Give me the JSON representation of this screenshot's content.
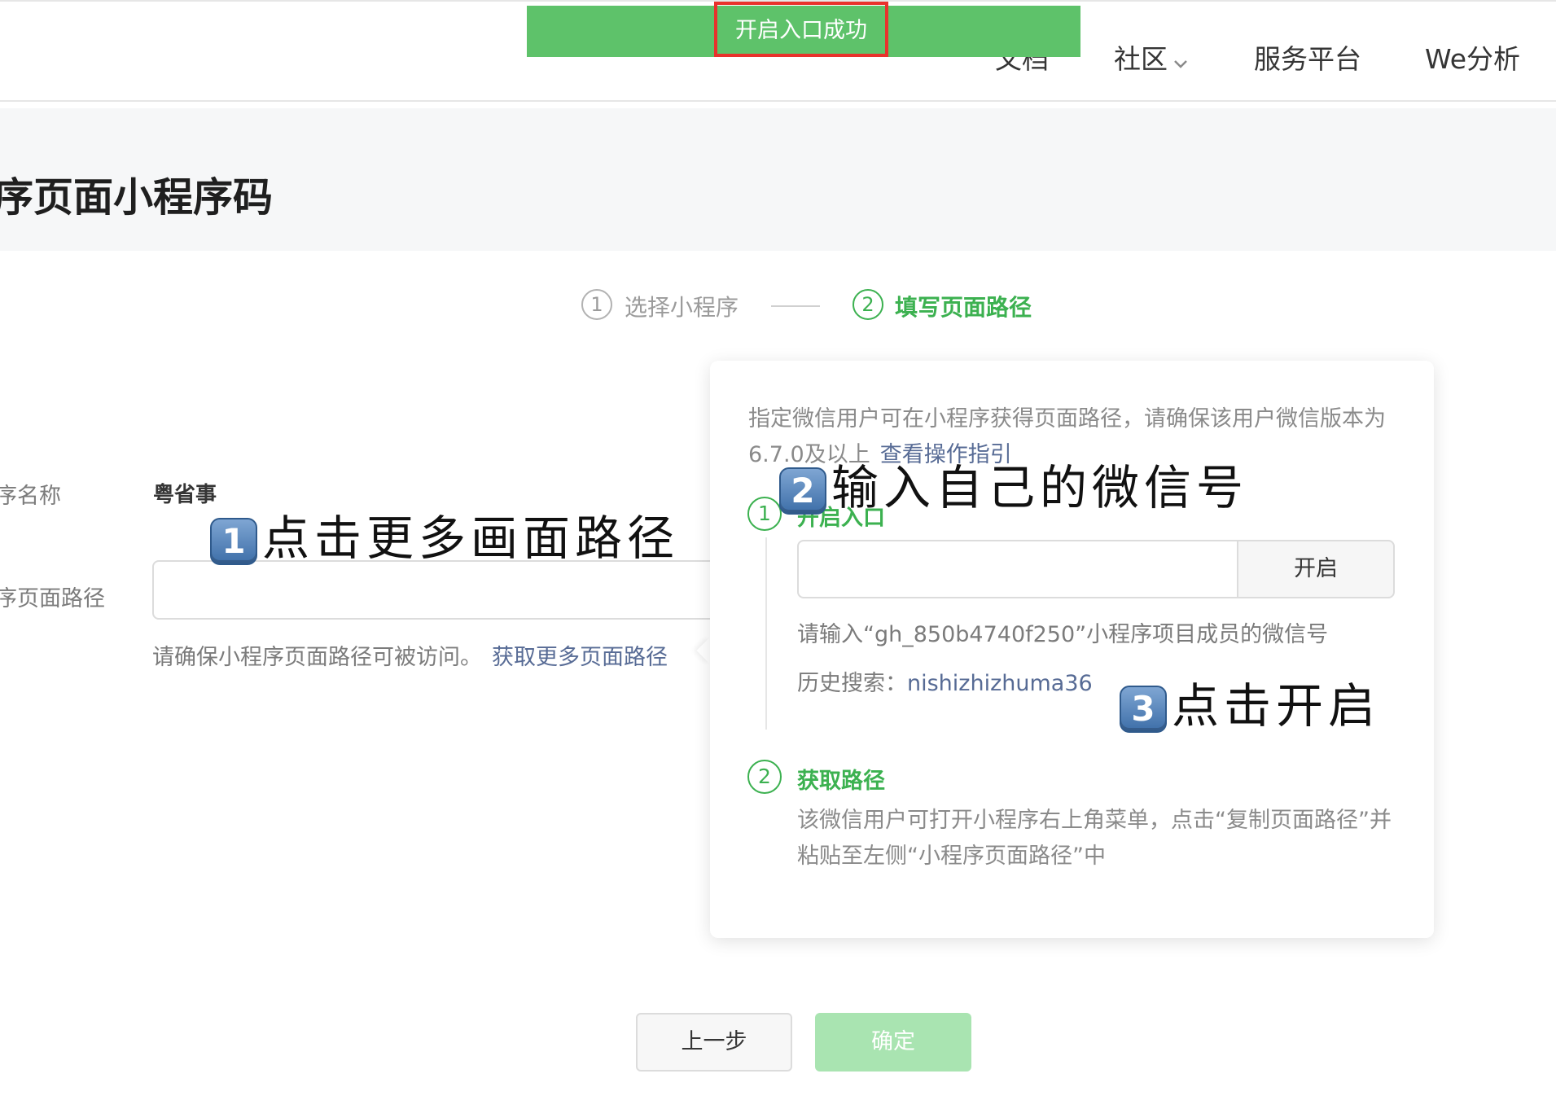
{
  "toast": {
    "text": "开启入口成功",
    "color": "#5ec26a",
    "highlight_color": "#e8322c"
  },
  "nav": {
    "docs": "文档",
    "community": "社区",
    "service": "服务平台",
    "we_analysis": "We分析"
  },
  "page": {
    "title": "序页面小程序码"
  },
  "steps": [
    {
      "number": "1",
      "label": "选择小程序",
      "state": "done"
    },
    {
      "number": "2",
      "label": "填写页面路径",
      "state": "active"
    }
  ],
  "form": {
    "name_label": "序名称",
    "name_value": "粤省事",
    "path_label": "序页面路径",
    "path_value": "",
    "path_hint": "请确保小程序页面路径可被访问。",
    "path_hint_link": "获取更多页面路径"
  },
  "popover": {
    "intro": "指定微信用户可在小程序获得页面路径，请确保该用户微信版本为6.7.0及以上",
    "intro_link": "查看操作指引",
    "step1": {
      "number": "1",
      "title": "开启入口",
      "input_value": "",
      "button": "开启",
      "hint": "请输入“gh_850b4740f250”小程序项目成员的微信号",
      "history_label": "历史搜索：",
      "history_value": "nishizhizhuma36"
    },
    "step2": {
      "number": "2",
      "title": "获取路径",
      "desc": "该微信用户可打开小程序右上角菜单，点击“复制页面路径”并粘贴至左侧“小程序页面路径”中"
    }
  },
  "buttons": {
    "prev": "上一步",
    "confirm": "确定"
  },
  "annotations": [
    {
      "num": "1",
      "text": "点击更多画面路径"
    },
    {
      "num": "2",
      "text": "输入自己的微信号"
    },
    {
      "num": "3",
      "text": "点击开启"
    }
  ],
  "colors": {
    "primary_green": "#3cb150",
    "link_blue": "#576b95"
  }
}
